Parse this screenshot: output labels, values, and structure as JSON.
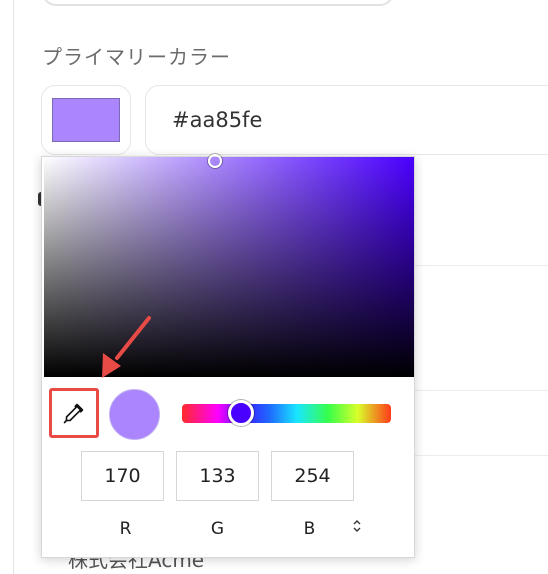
{
  "section": {
    "label": "プライマリーカラー"
  },
  "color": {
    "hex_value": "#aa85fe",
    "swatch": "#aa85fe",
    "hue_color": "#4a00ff"
  },
  "picker": {
    "rgb": {
      "r": "170",
      "g": "133",
      "b": "254"
    },
    "labels": {
      "r": "R",
      "g": "G",
      "b": "B"
    },
    "mode_toggle_icon": "⌃⌄",
    "hue_position": 0.27
  },
  "background": {
    "partial_text": "株式会社Acme"
  },
  "annotation": {
    "color": "#e84b45"
  }
}
